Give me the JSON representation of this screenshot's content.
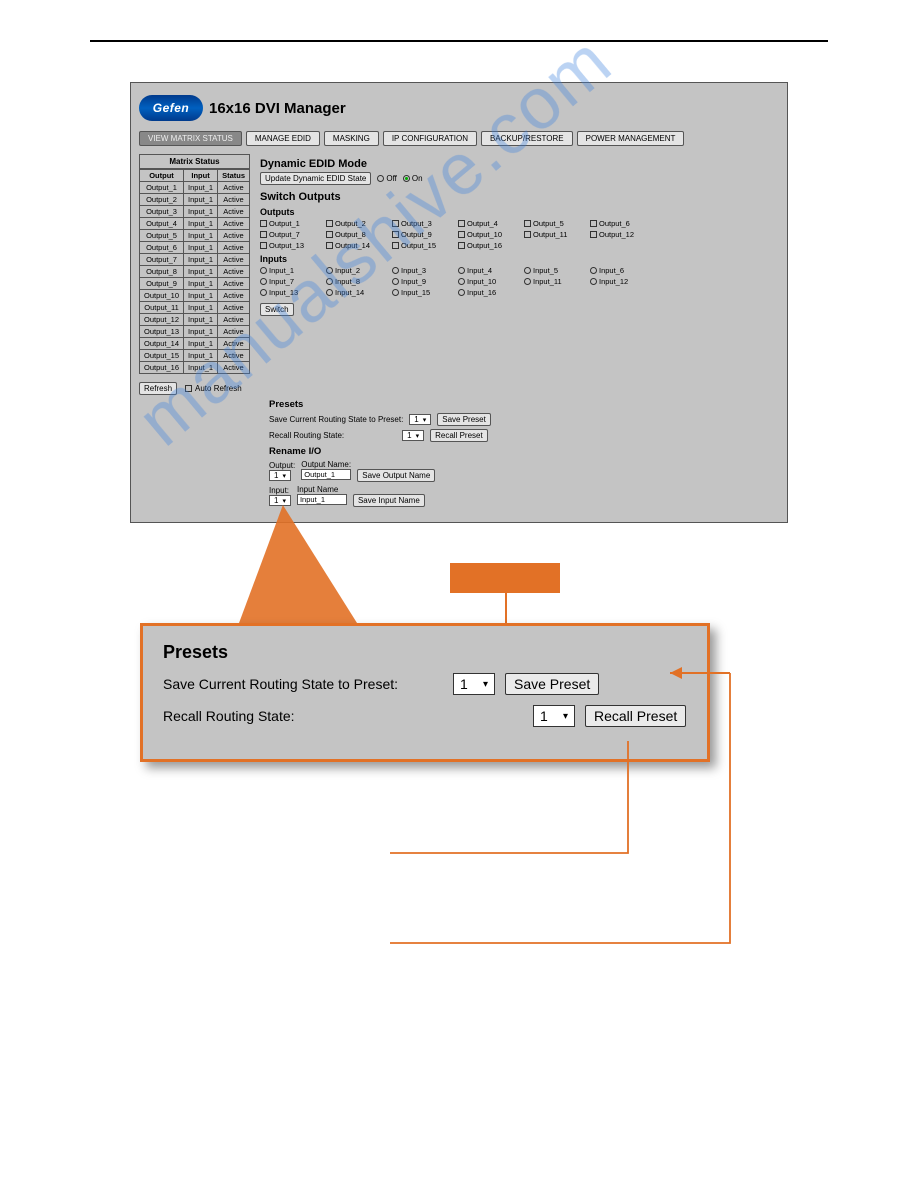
{
  "logo": "Gefen",
  "app_title": "16x16 DVI Manager",
  "tabs": [
    "VIEW MATRIX STATUS",
    "MANAGE EDID",
    "MASKING",
    "IP CONFIGURATION",
    "BACKUP/RESTORE",
    "POWER MANAGEMENT"
  ],
  "matrix": {
    "title": "Matrix Status",
    "cols": [
      "Output",
      "Input",
      "Status"
    ],
    "rows": [
      [
        "Output_1",
        "Input_1",
        "Active"
      ],
      [
        "Output_2",
        "Input_1",
        "Active"
      ],
      [
        "Output_3",
        "Input_1",
        "Active"
      ],
      [
        "Output_4",
        "Input_1",
        "Active"
      ],
      [
        "Output_5",
        "Input_1",
        "Active"
      ],
      [
        "Output_6",
        "Input_1",
        "Active"
      ],
      [
        "Output_7",
        "Input_1",
        "Active"
      ],
      [
        "Output_8",
        "Input_1",
        "Active"
      ],
      [
        "Output_9",
        "Input_1",
        "Active"
      ],
      [
        "Output_10",
        "Input_1",
        "Active"
      ],
      [
        "Output_11",
        "Input_1",
        "Active"
      ],
      [
        "Output_12",
        "Input_1",
        "Active"
      ],
      [
        "Output_13",
        "Input_1",
        "Active"
      ],
      [
        "Output_14",
        "Input_1",
        "Active"
      ],
      [
        "Output_15",
        "Input_1",
        "Active"
      ],
      [
        "Output_16",
        "Input_1",
        "Active"
      ]
    ]
  },
  "edid": {
    "title": "Dynamic EDID Mode",
    "update_btn": "Update Dynamic EDID State",
    "off": "Off",
    "on": "On"
  },
  "switch": {
    "title": "Switch Outputs",
    "outputs_label": "Outputs",
    "inputs_label": "Inputs",
    "outputs": [
      "Output_1",
      "Output_2",
      "Output_3",
      "Output_4",
      "Output_5",
      "Output_6",
      "Output_7",
      "Output_8",
      "Output_9",
      "Output_10",
      "Output_11",
      "Output_12",
      "Output_13",
      "Output_14",
      "Output_15",
      "Output_16"
    ],
    "inputs": [
      "Input_1",
      "Input_2",
      "Input_3",
      "Input_4",
      "Input_5",
      "Input_6",
      "Input_7",
      "Input_8",
      "Input_9",
      "Input_10",
      "Input_11",
      "Input_12",
      "Input_13",
      "Input_14",
      "Input_15",
      "Input_16"
    ],
    "switch_btn": "Switch"
  },
  "refresh": {
    "btn": "Refresh",
    "auto": "Auto Refresh"
  },
  "presets": {
    "title": "Presets",
    "save_label": "Save Current Routing State to Preset:",
    "save_val": "1",
    "save_btn": "Save Preset",
    "recall_label": "Recall Routing State:",
    "recall_val": "1",
    "recall_btn": "Recall Preset"
  },
  "rename": {
    "title": "Rename I/O",
    "output_label": "Output:",
    "output_val": "1",
    "output_name_label": "Output Name:",
    "output_name_val": "Output_1",
    "save_output_btn": "Save Output Name",
    "input_label": "Input:",
    "input_val": "1",
    "input_name_label": "Input Name",
    "input_name_val": "Input_1",
    "save_input_btn": "Save Input Name"
  },
  "zoom": {
    "title": "Presets",
    "save_label": "Save Current Routing State to Preset:",
    "save_val": "1",
    "save_btn": "Save Preset",
    "recall_label": "Recall Routing State:",
    "recall_val": "1",
    "recall_btn": "Recall Preset"
  },
  "watermark": "manualshive.com"
}
